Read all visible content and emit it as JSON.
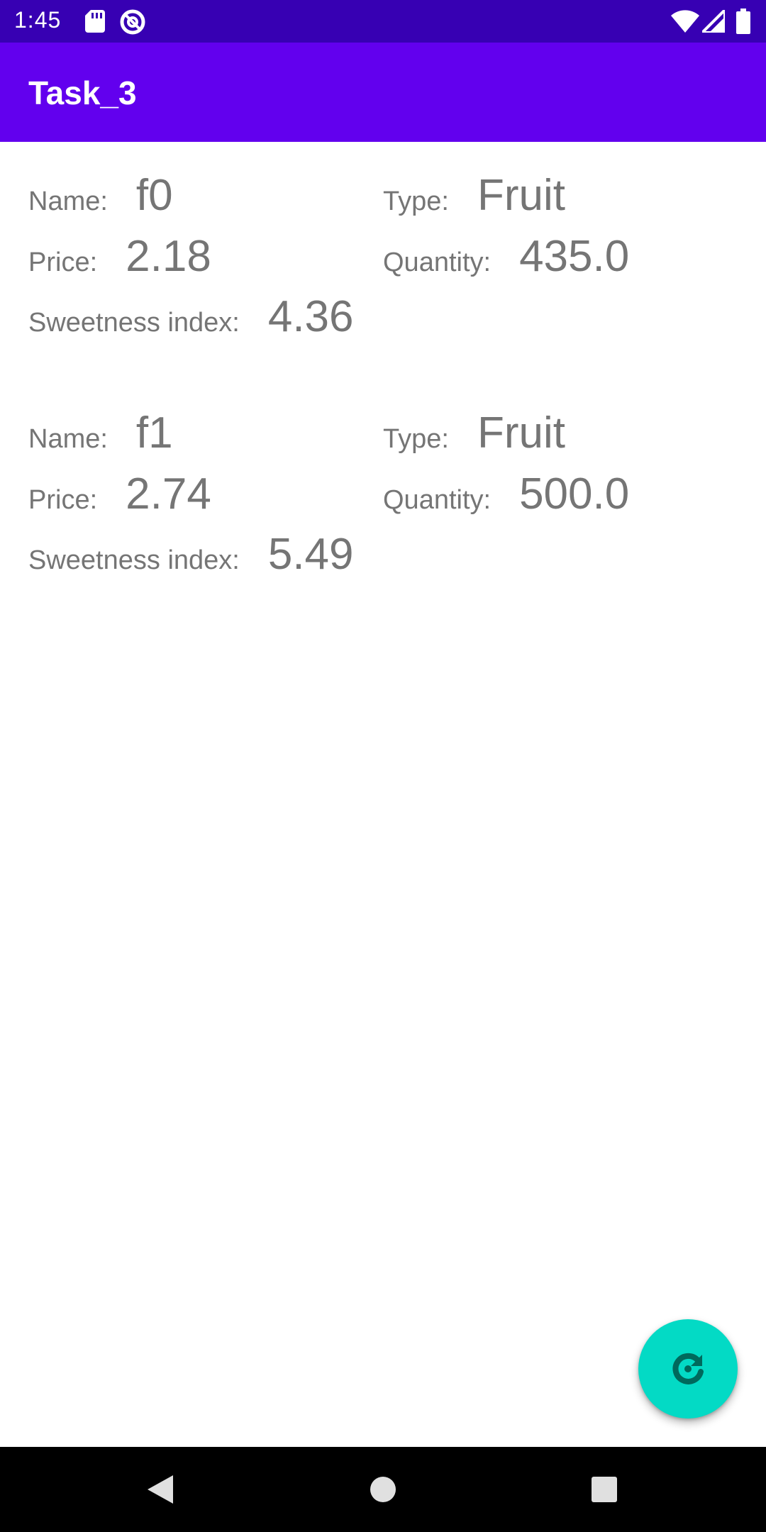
{
  "status_bar": {
    "time": "1:45",
    "icons": [
      "sd-card-icon",
      "at-sign-icon",
      "wifi-icon",
      "cell-signal-icon",
      "battery-icon"
    ]
  },
  "app_bar": {
    "title": "Task_3"
  },
  "items": [
    {
      "name_label": "Name:",
      "name_value": "f0",
      "type_label": "Type:",
      "type_value": "Fruit",
      "price_label": "Price:",
      "price_value": "2.18",
      "quantity_label": "Quantity:",
      "quantity_value": "435.0",
      "sweetness_label": "Sweetness index:",
      "sweetness_value": "4.36"
    },
    {
      "name_label": "Name:",
      "name_value": "f1",
      "type_label": "Type:",
      "type_value": "Fruit",
      "price_label": "Price:",
      "price_value": "2.74",
      "quantity_label": "Quantity:",
      "quantity_value": "500.0",
      "sweetness_label": "Sweetness index:",
      "sweetness_value": "5.49"
    }
  ],
  "fab": {
    "icon": "refresh-icon"
  },
  "nav_bar": {
    "icons": [
      "back-icon",
      "home-icon",
      "recents-icon"
    ]
  },
  "colors": {
    "status_bar": "#3700b3",
    "app_bar": "#6200ee",
    "fab": "#03dac5",
    "fab_icon": "#00695c",
    "text": "#757575"
  }
}
